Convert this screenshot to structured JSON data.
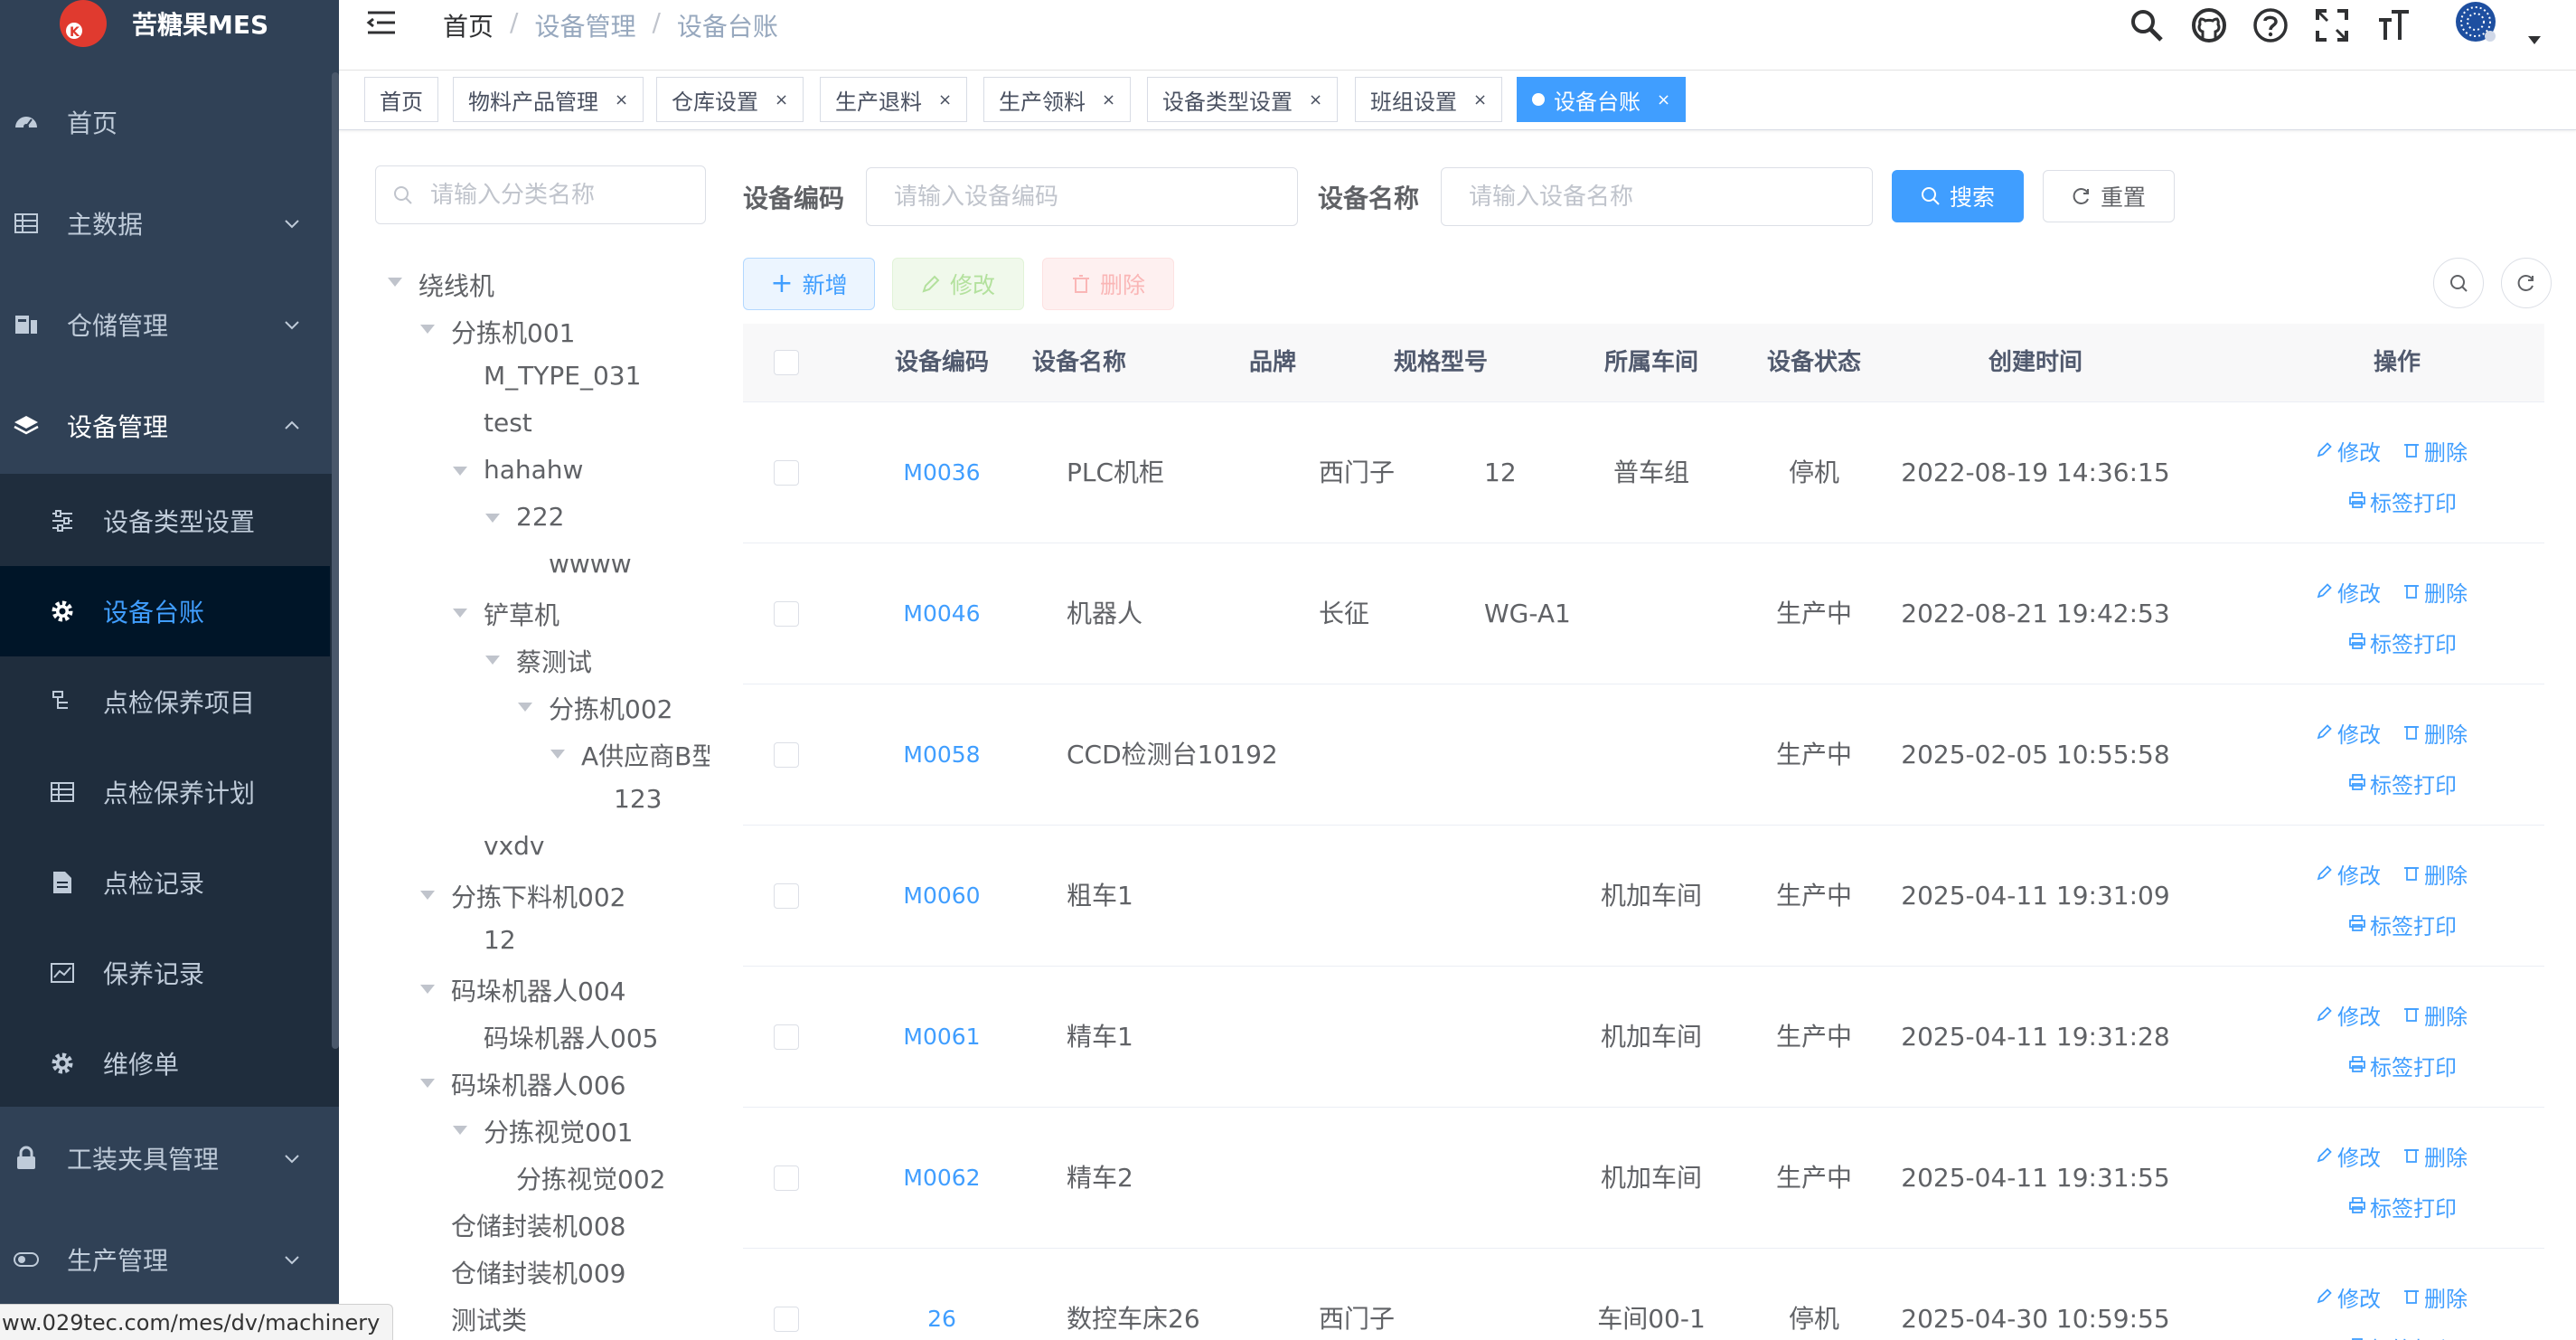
{
  "app": {
    "title": "苦糖果MES"
  },
  "sidebar": {
    "items": [
      {
        "label": "首页",
        "icon": "dashboard-icon"
      },
      {
        "label": "主数据",
        "icon": "table-icon"
      },
      {
        "label": "仓储管理",
        "icon": "warehouse-icon"
      },
      {
        "label": "设备管理",
        "icon": "layers-icon"
      },
      {
        "label": "工装夹具管理",
        "icon": "lock-icon"
      },
      {
        "label": "生产管理",
        "icon": "toggle-icon"
      }
    ],
    "sub_items": [
      {
        "label": "设备类型设置",
        "icon": "sliders-icon"
      },
      {
        "label": "设备台账",
        "icon": "gear-icon"
      },
      {
        "label": "点检保养项目",
        "icon": "tree-icon"
      },
      {
        "label": "点检保养计划",
        "icon": "grid-icon"
      },
      {
        "label": "点检记录",
        "icon": "document-icon"
      },
      {
        "label": "保养记录",
        "icon": "chart-icon"
      },
      {
        "label": "维修单",
        "icon": "gear-icon"
      }
    ]
  },
  "breadcrumb": [
    "首页",
    "设备管理",
    "设备台账"
  ],
  "tags": [
    {
      "label": "首页",
      "closable": false
    },
    {
      "label": "物料产品管理",
      "closable": true
    },
    {
      "label": "仓库设置",
      "closable": true
    },
    {
      "label": "生产退料",
      "closable": true
    },
    {
      "label": "生产领料",
      "closable": true
    },
    {
      "label": "设备类型设置",
      "closable": true
    },
    {
      "label": "班组设置",
      "closable": true
    },
    {
      "label": "设备台账",
      "closable": true,
      "active": true
    }
  ],
  "tag_close": "×",
  "tree": {
    "search_placeholder": "请输入分类名称",
    "nodes": [
      {
        "label": "绕线机"
      },
      {
        "label": "分拣机001"
      },
      {
        "label": "M_TYPE_031"
      },
      {
        "label": "test"
      },
      {
        "label": "hahahw"
      },
      {
        "label": "222"
      },
      {
        "label": "wwww"
      },
      {
        "label": "铲草机"
      },
      {
        "label": "蔡测试"
      },
      {
        "label": "分拣机002"
      },
      {
        "label": "A供应商B型号"
      },
      {
        "label": "123"
      },
      {
        "label": "vxdv"
      },
      {
        "label": "分拣下料机002"
      },
      {
        "label": "12"
      },
      {
        "label": "码垛机器人004"
      },
      {
        "label": "码垛机器人005"
      },
      {
        "label": "码垛机器人006"
      },
      {
        "label": "分拣视觉001"
      },
      {
        "label": "分拣视觉002"
      },
      {
        "label": "仓储封装机008"
      },
      {
        "label": "仓储封装机009"
      },
      {
        "label": "测试类"
      }
    ]
  },
  "filters": {
    "code_label": "设备编码",
    "code_placeholder": "请输入设备编码",
    "name_label": "设备名称",
    "name_placeholder": "请输入设备名称",
    "search_button": "搜索",
    "reset_button": "重置"
  },
  "toolbar": {
    "add": "新增",
    "edit": "修改",
    "delete": "删除"
  },
  "table": {
    "columns": [
      "设备编码",
      "设备名称",
      "品牌",
      "规格型号",
      "所属车间",
      "设备状态",
      "创建时间",
      "操作"
    ],
    "rows": [
      {
        "code": "M0036",
        "name": "PLC机柜",
        "brand": "西门子",
        "spec": "12",
        "workshop": "普车组",
        "status": "停机",
        "created": "2022-08-19 14:36:15"
      },
      {
        "code": "M0046",
        "name": "机器人",
        "brand": "长征",
        "spec": "WG-A1",
        "workshop": "",
        "status": "生产中",
        "created": "2022-08-21 19:42:53"
      },
      {
        "code": "M0058",
        "name": "CCD检测台10192",
        "brand": "",
        "spec": "",
        "workshop": "",
        "status": "生产中",
        "created": "2025-02-05 10:55:58"
      },
      {
        "code": "M0060",
        "name": "粗车1",
        "brand": "",
        "spec": "",
        "workshop": "机加车间",
        "status": "生产中",
        "created": "2025-04-11 19:31:09"
      },
      {
        "code": "M0061",
        "name": "精车1",
        "brand": "",
        "spec": "",
        "workshop": "机加车间",
        "status": "生产中",
        "created": "2025-04-11 19:31:28"
      },
      {
        "code": "M0062",
        "name": "精车2",
        "brand": "",
        "spec": "",
        "workshop": "机加车间",
        "status": "生产中",
        "created": "2025-04-11 19:31:55"
      },
      {
        "code": "26",
        "name": "数控车床26",
        "brand": "西门子",
        "spec": "",
        "workshop": "车间00-1",
        "status": "停机",
        "created": "2025-04-30 10:59:55"
      }
    ],
    "op_edit": "修改",
    "op_delete": "删除",
    "op_print": "标签打印"
  },
  "status_url": "ww.029tec.com/mes/dv/machinery",
  "colors": {
    "sidebar": "#304156",
    "submenu": "#1f2d3d",
    "accent": "#409eff"
  }
}
